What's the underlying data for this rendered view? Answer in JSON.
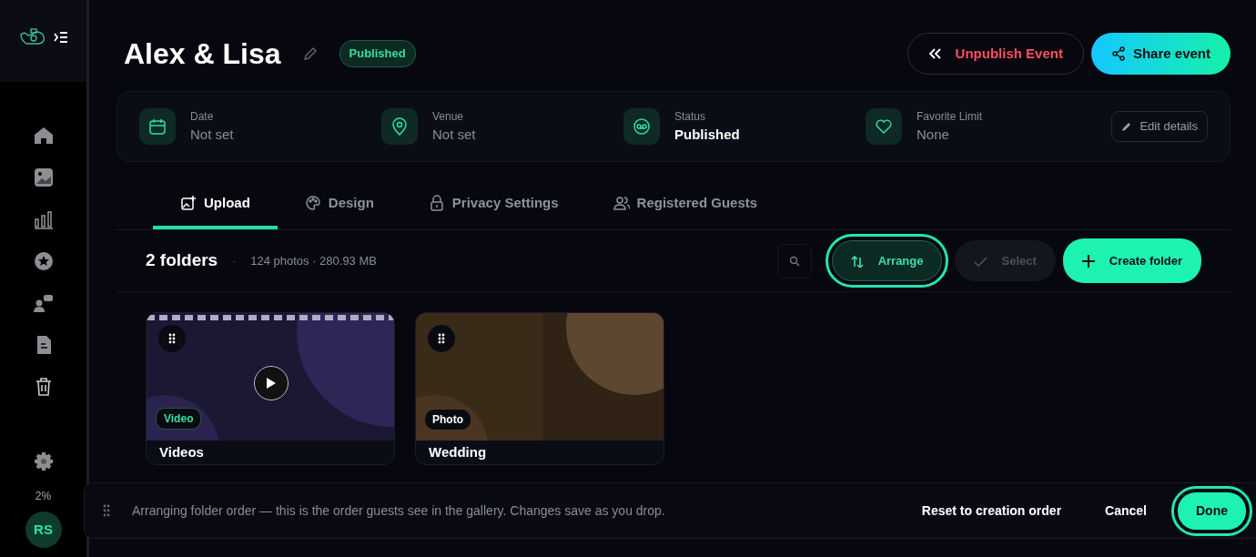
{
  "sidebar": {
    "storage": "2%",
    "avatar": "RS"
  },
  "event": {
    "title": "Alex & Lisa",
    "status_badge": "Published"
  },
  "actions": [
    {
      "label": "Unpublish Event",
      "kind": "outline"
    },
    {
      "label": "Share event",
      "kind": "gradient"
    }
  ],
  "details": [
    {
      "kind": "date",
      "label": "Date",
      "value": "Not set",
      "set": false
    },
    {
      "kind": "venue",
      "label": "Venue",
      "value": "Not set",
      "set": false
    },
    {
      "kind": "status",
      "label": "Status",
      "value": "Published",
      "set": true
    },
    {
      "kind": "favorite",
      "label": "Favorite Limit",
      "value": "None",
      "set": false
    }
  ],
  "edit_details": "Edit details",
  "tabs": [
    {
      "kind": "upload",
      "label": "Upload",
      "selected": true
    },
    {
      "kind": "design",
      "label": "Design",
      "selected": false
    },
    {
      "kind": "privacy",
      "label": "Privacy Settings",
      "selected": false
    },
    {
      "kind": "guests",
      "label": "Registered Guests",
      "selected": false
    }
  ],
  "toolbar": {
    "count": "2 folders",
    "separator": "·",
    "meta": "124 photos · 280.93 MB",
    "buttons": [
      {
        "kind": "arrange",
        "label": "Arrange",
        "disabled": false,
        "highlighted": true
      },
      {
        "kind": "select",
        "label": "Select",
        "disabled": true,
        "highlighted": false
      },
      {
        "kind": "create",
        "label": "Create folder",
        "disabled": false,
        "highlighted": false
      }
    ]
  },
  "folders": [
    {
      "kind": "video",
      "name": "Videos",
      "type": "Video"
    },
    {
      "kind": "photo",
      "name": "Wedding",
      "type": "Photo"
    }
  ],
  "arrange_bar": {
    "message": "Arranging folder order — this is the order guests see in the gallery. Changes save as you drop.",
    "buttons": [
      {
        "kind": "link",
        "label": "Reset to creation order",
        "highlighted": false
      },
      {
        "kind": "link",
        "label": "Cancel",
        "highlighted": false
      },
      {
        "kind": "primary",
        "label": "Done",
        "highlighted": true
      }
    ]
  }
}
